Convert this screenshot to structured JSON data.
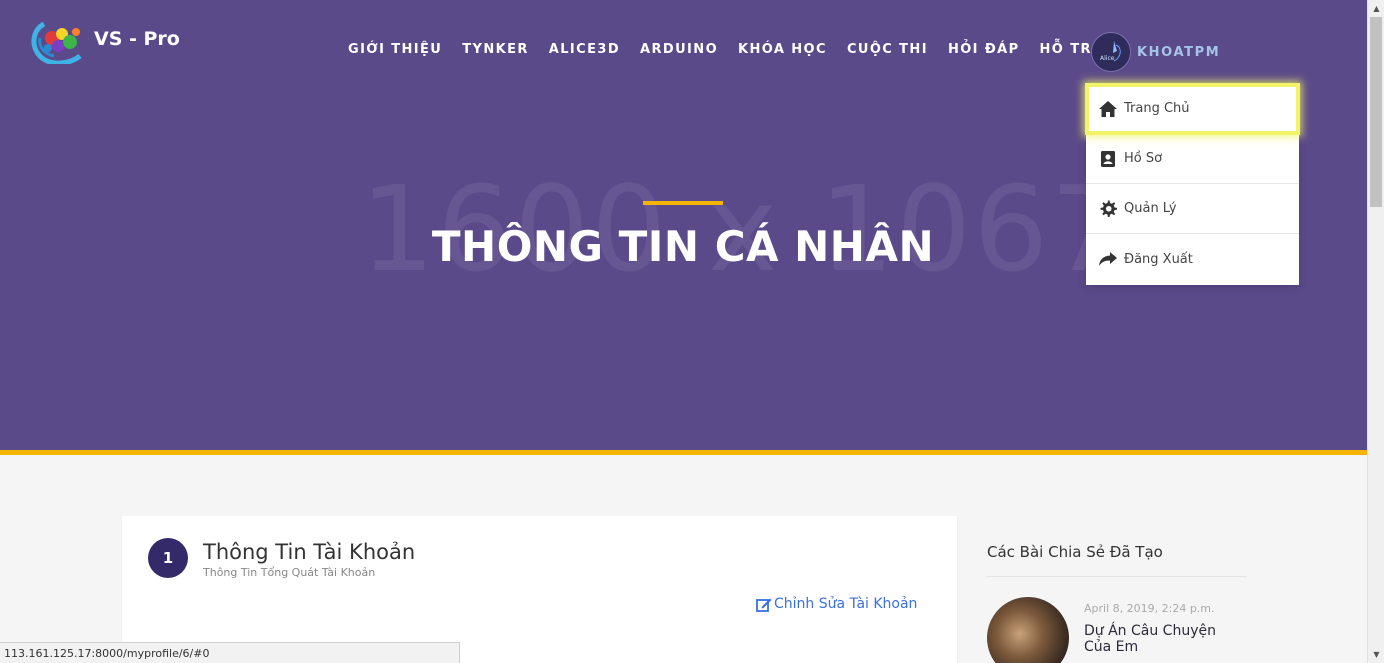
{
  "brand": {
    "name": "VS - Pro"
  },
  "nav": {
    "items": [
      {
        "label": "GIỚI THIỆU"
      },
      {
        "label": "TYNKER"
      },
      {
        "label": "ALICE3D"
      },
      {
        "label": "ARDUINO"
      },
      {
        "label": "KHÓA HỌC"
      },
      {
        "label": "CUỘC THI"
      },
      {
        "label": "HỎI ĐÁP"
      },
      {
        "label": "HỖ TRỢ"
      }
    ],
    "user": {
      "name": "KHOATPM",
      "avatar_text": "Alice"
    }
  },
  "dropdown": {
    "items": [
      {
        "label": "Trang Chủ",
        "icon": "home-icon"
      },
      {
        "label": "Hồ Sơ",
        "icon": "contact-book-icon"
      },
      {
        "label": "Quản Lý",
        "icon": "gear-icon"
      },
      {
        "label": "Đăng Xuất",
        "icon": "share-arrow-icon"
      }
    ]
  },
  "hero": {
    "title": "THÔNG TIN CÁ NHÂN",
    "placeholder_text": "1600 x 1067"
  },
  "account_card": {
    "step": "1",
    "title": "Thông Tin Tài Khoản",
    "subtitle": "Thông Tin Tổng Quát Tài Khoản",
    "edit_label": "Chỉnh Sửa Tài Khoản"
  },
  "sidebar": {
    "title": "Các Bài Chia Sẻ Đã Tạo",
    "posts": [
      {
        "date": "April 8, 2019, 2:24 p.m.",
        "title": "Dự Án Câu Chuyện Của Em"
      }
    ]
  },
  "statusbar": {
    "url": "113.161.125.17:8000/myprofile/6/#0"
  },
  "colors": {
    "hero_bg": "#5b4a8a",
    "accent": "#f5b400",
    "step_circle": "#342a6a",
    "link": "#3a70e0",
    "highlight": "#f3f36a"
  }
}
